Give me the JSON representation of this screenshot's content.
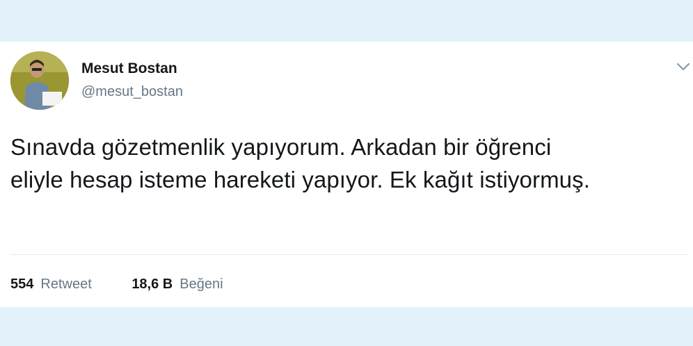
{
  "tweet": {
    "author_name": "Mesut Bostan",
    "author_handle": "@mesut_bostan",
    "text_line1": "Sınavda gözetmenlik yapıyorum. Arkadan bir öğrenci",
    "text_line2": "eliyle hesap isteme hareketi yapıyor. Ek kağıt istiyormuş.",
    "menu_icon": "chevron-down-icon"
  },
  "stats": {
    "retweets_count": "554",
    "retweets_label": "Retweet",
    "likes_count": "18,6 B",
    "likes_label": "Beğeni"
  },
  "colors": {
    "background": "#e3f1fa",
    "card": "#ffffff",
    "text": "#14171a",
    "secondary_text": "#657786"
  }
}
